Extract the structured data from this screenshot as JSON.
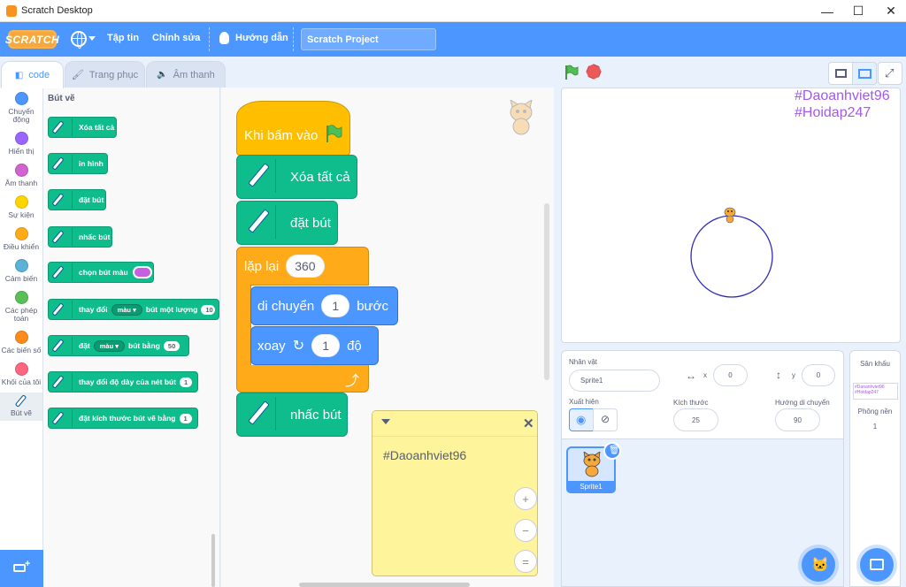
{
  "window": {
    "title": "Scratch Desktop",
    "minimize": "—",
    "maximize": "☐",
    "close": "✕"
  },
  "menubar": {
    "logo": "SCRATCH",
    "file": "Tập tin",
    "edit": "Chỉnh sửa",
    "tutorials": "Hướng dẫn",
    "project_title": "Scratch Project"
  },
  "tabs": [
    {
      "label": "code"
    },
    {
      "label": "Trang phục"
    },
    {
      "label": "Âm thanh"
    }
  ],
  "categories": [
    {
      "label": "Chuyển động",
      "color": "#4c97ff"
    },
    {
      "label": "Hiển thị",
      "color": "#9966ff"
    },
    {
      "label": "Âm thanh",
      "color": "#cf63cf"
    },
    {
      "label": "Sự kiện",
      "color": "#ffd500"
    },
    {
      "label": "Điều khiển",
      "color": "#ffab19"
    },
    {
      "label": "Cảm biến",
      "color": "#5cb1d6"
    },
    {
      "label": "Các phép toán",
      "color": "#59c059"
    },
    {
      "label": "Các biến số",
      "color": "#ff8c1a"
    },
    {
      "label": "Khối của tôi",
      "color": "#ff6680"
    },
    {
      "label": "Bút vẽ",
      "color": "#0fbd8c"
    }
  ],
  "palette": {
    "title": "Bút vẽ",
    "clear": "Xóa tất cả",
    "stamp": "in hình",
    "pen_down": "đặt bút",
    "pen_up": "nhấc bút",
    "set_color": "chọn bút màu",
    "change_param": {
      "prefix": "thay đổi",
      "dropdown": "màu",
      "suffix": "bút một lượng",
      "value": "10"
    },
    "set_param": {
      "prefix": "đặt",
      "dropdown": "màu",
      "suffix": "bút bằng",
      "value": "50"
    },
    "change_size": {
      "text": "thay đổi độ dày của nét bút",
      "value": "1"
    },
    "set_size": {
      "text": "đặt kích thước bút vẽ bằng",
      "value": "1"
    }
  },
  "script": {
    "hat": "Khi bấm vào",
    "clear": "Xóa tất cả",
    "pen_down": "đặt bút",
    "repeat": {
      "label": "lặp lại",
      "value": "360"
    },
    "move": {
      "prefix": "di chuyển",
      "value": "1",
      "suffix": "bước"
    },
    "turn": {
      "prefix": "xoay",
      "value": "1",
      "suffix": "độ"
    },
    "pen_up": "nhấc bút"
  },
  "note": {
    "text": "#Daoanhviet96"
  },
  "zoom": {
    "in": "+",
    "out": "−",
    "reset": "="
  },
  "stage": {
    "line1": "#Daoanhviet96",
    "line2": "#Hoidap247"
  },
  "sprite_info": {
    "sprite_label": "Nhân vật",
    "sprite_name": "Sprite1",
    "x_label": "x",
    "x": "0",
    "y_label": "y",
    "y": "0",
    "show_label": "Xuất hiện",
    "size_label": "Kích thước",
    "size": "25",
    "direction_label": "Hướng di chuyển",
    "direction": "90"
  },
  "sprites": [
    {
      "name": "Sprite1"
    }
  ],
  "stage_pane": {
    "title": "Sân khấu",
    "thumb_line1": "#Daoanhviet96",
    "thumb_line2": "#Hoidap247",
    "backdrops_label": "Phông nền",
    "backdrops_count": "1"
  }
}
